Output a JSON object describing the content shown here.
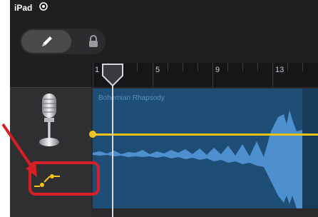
{
  "status_bar": {
    "device": "iPad"
  },
  "toolbar": {
    "edit_mode": "pencil",
    "lock": "lock"
  },
  "ruler": {
    "markers": [
      "1",
      "5",
      "9",
      "13"
    ]
  },
  "track": {
    "instrument_icon": "microphone-icon",
    "automation_icon": "automation-icon",
    "region_name": "Bohemian Rhapsody"
  },
  "annotation": {
    "arrow_color": "#d62027",
    "highlight_color": "#d62027"
  },
  "colors": {
    "region": "#1e4e76",
    "automation": "#f2c318"
  }
}
